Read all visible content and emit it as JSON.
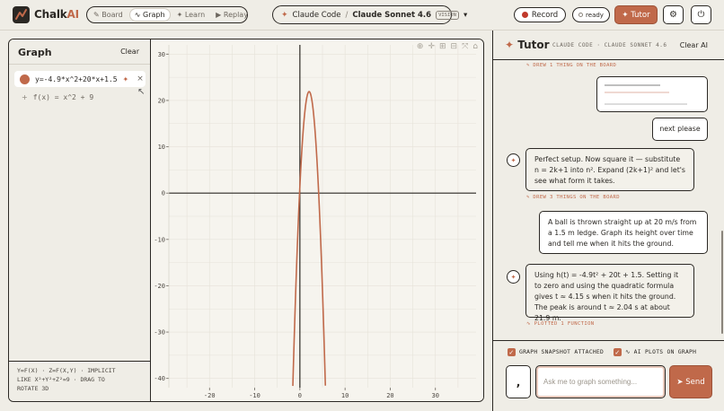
{
  "app": {
    "name_prefix": "Chalk",
    "name_suffix": "AI"
  },
  "modes": [
    {
      "icon": "✎",
      "label": "Board"
    },
    {
      "icon": "∿",
      "label": "Graph"
    },
    {
      "icon": "✦",
      "label": "Learn"
    },
    {
      "icon": "▶",
      "label": "Replay"
    }
  ],
  "session": {
    "provider": "Claude Code",
    "separator": "/",
    "model": "Claude Sonnet 4.6",
    "badge": "VISION",
    "dropdown": "▾"
  },
  "header": {
    "record_label": "Record",
    "status_label": "ready",
    "tutor_label": "✦ Tutor",
    "settings_icon": "⚙",
    "power_icon": "⏻"
  },
  "graph": {
    "title": "Graph",
    "clear_label": "Clear",
    "functions": [
      {
        "expr": "y=-4.9*x^2+20*x+1.5",
        "color": "#c0694a"
      }
    ],
    "add_placeholder": "f(x) = x^2 + 9",
    "help_line1": "Y=F(X) · Z=F(X,Y) · IMPLICIT",
    "help_line2": "LIKE X²+Y²+Z²=9 · DRAG TO",
    "help_line3": "ROTATE 3D"
  },
  "chart_data": {
    "type": "line",
    "title": "",
    "xlabel": "",
    "ylabel": "",
    "xlim": [
      -29,
      39
    ],
    "ylim": [
      -42,
      32
    ],
    "x_ticks": [
      -20,
      -10,
      0,
      10,
      20,
      30
    ],
    "y_ticks": [
      30,
      20,
      10,
      0,
      -10,
      -20,
      -30,
      -40
    ],
    "x_tick_labels": [
      "-20",
      "-10",
      "0",
      "10",
      "20",
      "30"
    ],
    "y_tick_labels": [
      "30",
      "20",
      "10",
      "0",
      "-10",
      "-20",
      "-30",
      "-40"
    ],
    "grid": true,
    "series": [
      {
        "expr": "y=-4.9*x^2+20*x+1.5",
        "a": -4.9,
        "b": 20,
        "c": 1.5,
        "color": "#c0694a"
      }
    ]
  },
  "tutor": {
    "title": "Tutor",
    "subtitle": "CLAUDE CODE · CLAUDE SONNET 4.6",
    "clear_label": "Clear AI",
    "messages": [
      {
        "meta": "✎ DREW 1 THING ON THE BOARD"
      },
      {
        "user": "next please"
      },
      {
        "ai": "Perfect setup. Now square it — substitute n = 2k+1 into n². Expand (2k+1)² and let's see what form it takes.",
        "meta": "✎ DREW 3 THINGS ON THE BOARD"
      },
      {
        "user": "A ball is thrown straight up at 20 m/s from a 1.5 m ledge. Graph its height over time and tell me when it hits the ground."
      },
      {
        "ai": "Using h(t) = -4.9t² + 20t + 1.5. Setting it to zero and using the quadratic formula gives t ≈ 4.15 s when it hits the ground. The peak is around t ≈ 2.04 s at about 21.9 m.",
        "meta": "∿ PLOTTED 1 FUNCTION"
      }
    ],
    "snapshot_label": "GRAPH SNAPSHOT ATTACHED",
    "ai_plots_label": "∿ AI PLOTS ON GRAPH",
    "input_placeholder": "Ask me to graph something...",
    "send_label": "➤ Send",
    "mic_label": ","
  }
}
